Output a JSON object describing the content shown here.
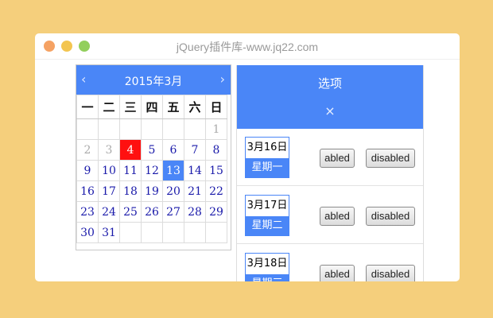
{
  "window": {
    "title": "jQuery插件库-www.jq22.com"
  },
  "calendar": {
    "title": "2015年3月",
    "prev": "‹",
    "next": "›",
    "weekdays": [
      "一",
      "二",
      "三",
      "四",
      "五",
      "六",
      "日"
    ],
    "weeks": [
      [
        "",
        "",
        "",
        "",
        "",
        "",
        "1"
      ],
      [
        "2",
        "3",
        "4",
        "5",
        "6",
        "7",
        "8"
      ],
      [
        "9",
        "10",
        "11",
        "12",
        "13",
        "14",
        "15"
      ],
      [
        "16",
        "17",
        "18",
        "19",
        "20",
        "21",
        "22"
      ],
      [
        "23",
        "24",
        "25",
        "26",
        "27",
        "28",
        "29"
      ],
      [
        "30",
        "31",
        "",
        "",
        "",
        "",
        ""
      ]
    ],
    "today": "4",
    "selected": "13",
    "accent_color": "#4a86f7",
    "today_color": "#ff1010"
  },
  "panel": {
    "title": "选项",
    "close": "×",
    "rows": [
      {
        "date": "3月16日",
        "weekday": "星期一",
        "abled": "abled",
        "disabled": "disabled"
      },
      {
        "date": "3月17日",
        "weekday": "星期二",
        "abled": "abled",
        "disabled": "disabled"
      },
      {
        "date": "3月18日",
        "weekday": "星期三",
        "abled": "abled",
        "disabled": "disabled"
      }
    ]
  }
}
